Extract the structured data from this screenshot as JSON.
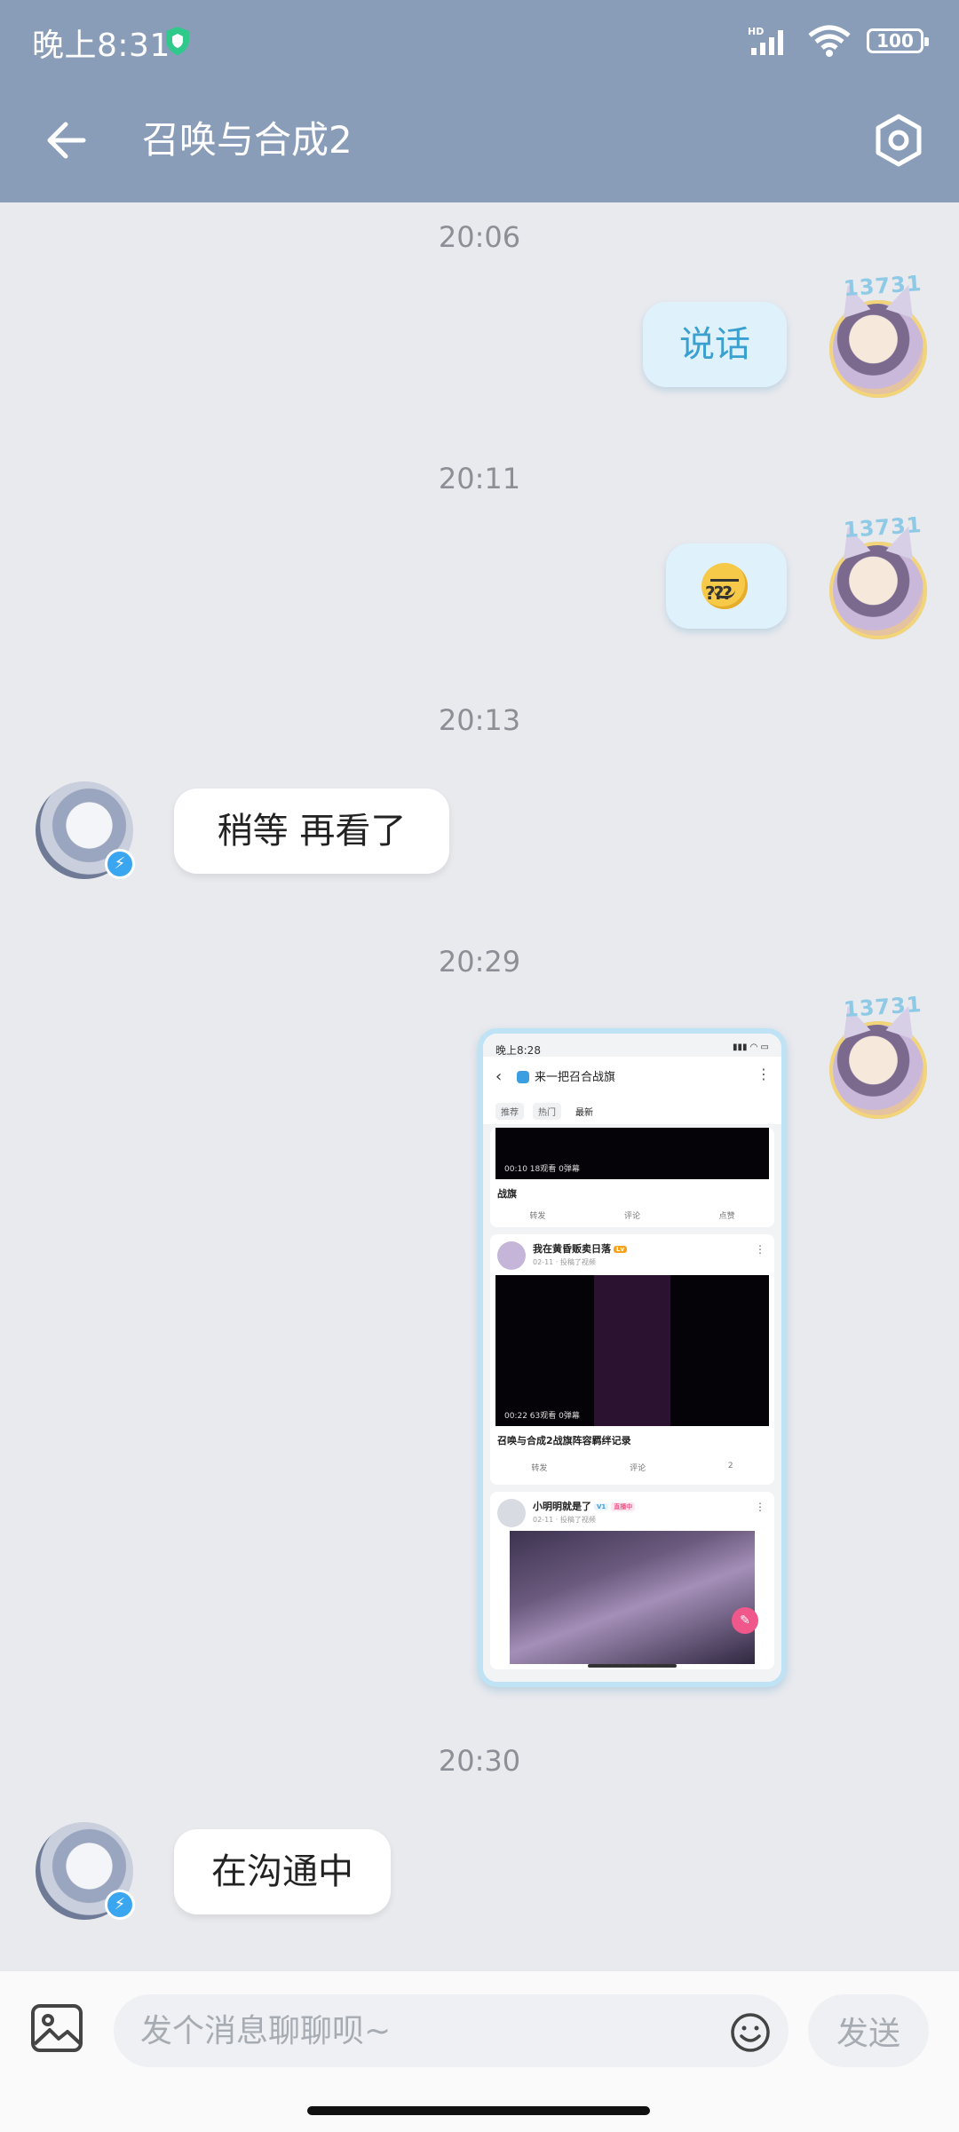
{
  "status_bar": {
    "time": "晚上8:31",
    "battery": "100",
    "network": "HD"
  },
  "header": {
    "title": "召唤与合成2"
  },
  "messages": [
    {
      "timestamp": "20:06",
      "from": "me",
      "text": "说话"
    },
    {
      "timestamp": "20:11",
      "from": "me",
      "type": "emoji",
      "emoji_name": "confused-question-emoji"
    },
    {
      "timestamp": "20:13",
      "from": "them",
      "text": "稍等  再看了"
    },
    {
      "timestamp": "20:29",
      "from": "me",
      "type": "image"
    },
    {
      "timestamp": "20:30",
      "from": "them",
      "text": "在沟通中"
    }
  ],
  "avatar_tag": "13731",
  "screenshot": {
    "status_time": "晚上8:28",
    "group_name": "来一把召合战旗",
    "tabs": [
      "推荐",
      "热门",
      "最新"
    ],
    "post1": {
      "video_meta": "00:10   18观看   0弹幕",
      "caption": "战旗",
      "actions": [
        "转发",
        "评论",
        "点赞"
      ]
    },
    "post2": {
      "user": "我在黄昏贩卖日落",
      "sub": "02-11 · 投稿了视频",
      "video_meta": "00:22   63观看   0弹幕",
      "caption": "召唤与合成2战旗阵容羁绊记录",
      "actions": [
        "转发",
        "评论",
        "2"
      ]
    },
    "post3": {
      "user": "小明明就是了",
      "badge": "直播中",
      "sub": "02-11 · 投稿了视频"
    }
  },
  "input_bar": {
    "placeholder": "发个消息聊聊呗~",
    "send_label": "发送"
  },
  "colors": {
    "header": "#8a9db8",
    "bubble_me": "#dff1fb",
    "bubble_me_text": "#3aa0cf",
    "background": "#e9eaee"
  }
}
